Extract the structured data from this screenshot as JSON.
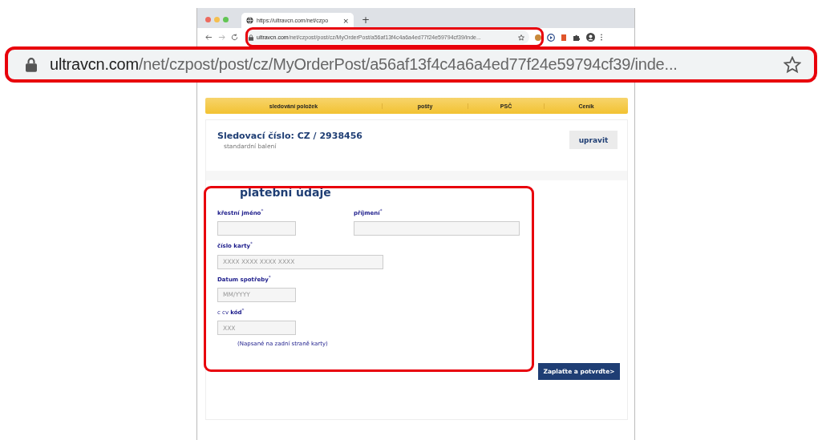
{
  "browser": {
    "tab_title": "https://ultravcn.com/net/czpo",
    "tab_close": "×",
    "new_tab": "+",
    "url_host": "ultravcn.com",
    "url_path": "/net/czpost/post/cz/MyOrderPost/a56af13f4c4a6a4ed77f24e59794cf39/inde..."
  },
  "zoomed_address_bar": {
    "url_host": "ultravcn.com",
    "url_path": "/net/czpost/post/cz/MyOrderPost/a56af13f4c4a6a4ed77f24e59794cf39/inde..."
  },
  "nav": [
    "sledování položek",
    "pošty",
    "PSČ",
    "Ceník"
  ],
  "tracking": {
    "title": "Sledovací číslo: CZ / 2938456",
    "subtitle": "standardní balení",
    "edit_button": "upravit"
  },
  "payment": {
    "heading": "platební údaje",
    "fields": [
      {
        "label": "**křestní jméno**$^{*}$"
      },
      {
        "label": "**příjmení**$^{*}$"
      },
      {
        "label": "**číslo karty**$^{*}$",
        "placeholder": "XXXX XXXX XXXX XXXX"
      },
      {
        "label": "**Datum spotřeby**$^{*}$",
        "placeholder": "MM/YYYY"
      },
      {
        "label": "c cv **kód**$^{*}$",
        "placeholder": "XXX"
      }
    ],
    "note": "(Napsané na zadní straně karty)",
    "submit": "Zaplaťte a potvrďte>"
  }
}
